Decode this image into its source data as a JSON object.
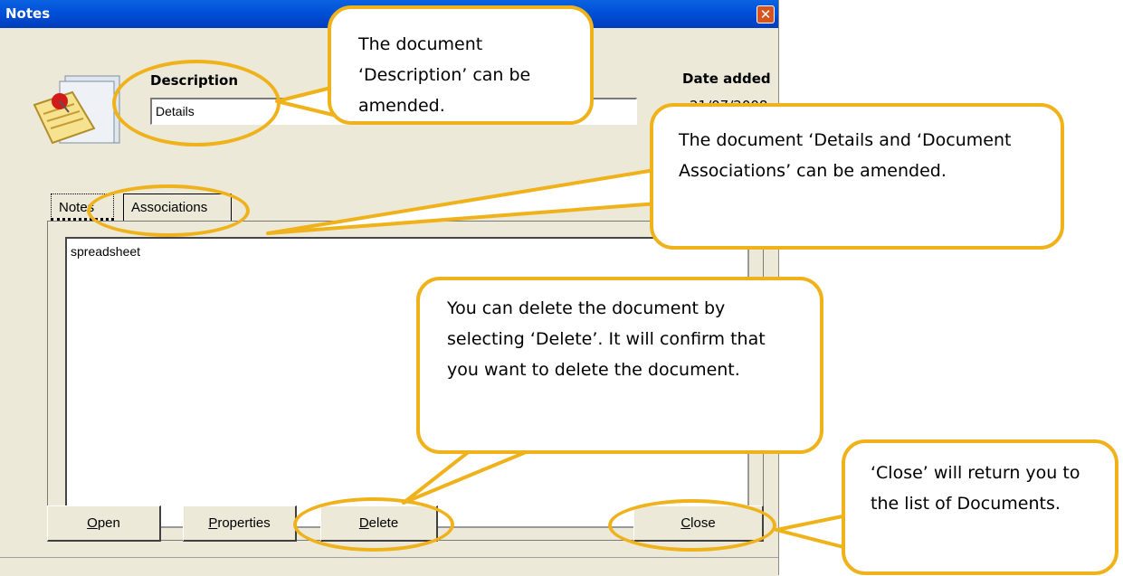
{
  "window": {
    "title": "Notes",
    "close_glyph": "✕"
  },
  "fields": {
    "description_label": "Description",
    "description_value": "Details",
    "date_added_label": "Date added",
    "date_added_value": "21/07/2008"
  },
  "tabs": [
    {
      "label": "Notes",
      "active": true
    },
    {
      "label": "Associations",
      "active": false
    }
  ],
  "notes_text": "spreadsheet",
  "buttons": {
    "open": {
      "mnemonic": "O",
      "rest": "pen"
    },
    "properties": {
      "mnemonic": "P",
      "rest": "roperties"
    },
    "delete": {
      "mnemonic": "D",
      "rest": "elete"
    },
    "close": {
      "mnemonic": "C",
      "rest": "lose"
    }
  },
  "callouts": {
    "description": "The document ‘Description’ can be amended.",
    "details": "The document ‘Details and ‘Document Associations’ can be amended.",
    "delete": "You can delete the document by selecting ‘Delete’. It will confirm that you want to delete the document.",
    "close": "‘Close’ will return you to the list of Documents."
  },
  "colors": {
    "callout_border": "#efb21a",
    "titlebar": "#0050d8",
    "window_face": "#ece9d8"
  },
  "icons": [
    "notepad-pushpin-icon",
    "close-icon"
  ]
}
